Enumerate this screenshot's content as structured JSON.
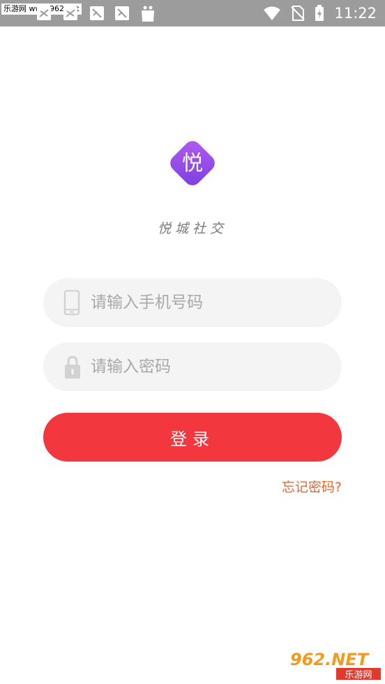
{
  "status_bar": {
    "watermark": "乐游网 www.962.net",
    "time": "11:22",
    "icons": [
      "warning-icon",
      "notification-icon",
      "notification-icon",
      "notification-icon",
      "notification-icon",
      "shopping-bag-icon",
      "wifi-icon",
      "no-sim-icon",
      "battery-charging-icon"
    ],
    "bg_color": "#9c9c9c"
  },
  "logo": {
    "glyph": "悦",
    "gradient": [
      "#b35cf0",
      "#7a3fe0"
    ]
  },
  "app_name": "悦城社交",
  "form": {
    "phone_placeholder": "请输入手机号码",
    "phone_value": "",
    "password_placeholder": "请输入密码",
    "password_value": "",
    "phone_icon": "phone-icon",
    "password_icon": "lock-icon"
  },
  "login_button": "登录",
  "forgot_password": "忘记密码?",
  "bottom_watermark": {
    "top": "962.NET",
    "bottom": "乐游网"
  },
  "colors": {
    "accent": "#f2373f",
    "link": "#e8652b",
    "field_bg": "#f4f4f4",
    "placeholder": "#a8a8a8"
  }
}
